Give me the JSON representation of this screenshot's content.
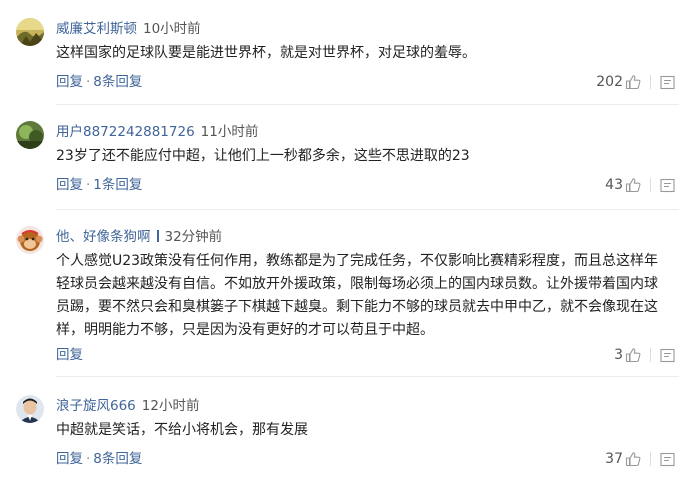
{
  "comments": [
    {
      "username": "威廉艾利斯顿",
      "time": "10小时前",
      "text": "这样国家的足球队要是能进世界杯，就是对世界杯，对足球的羞辱。",
      "reply_label": "回复",
      "dot": "·",
      "replies_label": "8条回复",
      "likes": "202",
      "avatar_icon": "landscape-avatar"
    },
    {
      "username": "用户8872242881726",
      "time": "11小时前",
      "text": "23岁了还不能应付中超，让他们上一秒都多余，这些不思进取的23",
      "reply_label": "回复",
      "dot": "·",
      "replies_label": "1条回复",
      "likes": "43",
      "avatar_icon": "nature-avatar"
    },
    {
      "username": "他、好像条狗啊",
      "time": "32分钟前",
      "text": "个人感觉U23政策没有任何作用，教练都是为了完成任务，不仅影响比赛精彩程度，而且总这样年轻球员会越来越没有自信。不如放开外援政策，限制每场必须上的国内球员数。让外援带着国内球员踢，要不然只会和臭棋篓子下棋越下越臭。剩下能力不够的球员就去中甲中乙，就不会像现在这样，明明能力不够，只是因为没有更好的才可以苟且于中超。",
      "reply_label": "回复",
      "likes": "3",
      "avatar_icon": "monkey-avatar"
    },
    {
      "username": "浪子旋风666",
      "time": "12小时前",
      "text": "中超就是笑话，不给小将机会，那有发展",
      "reply_label": "回复",
      "dot": "·",
      "replies_label": "8条回复",
      "likes": "37",
      "avatar_icon": "person-avatar"
    }
  ]
}
